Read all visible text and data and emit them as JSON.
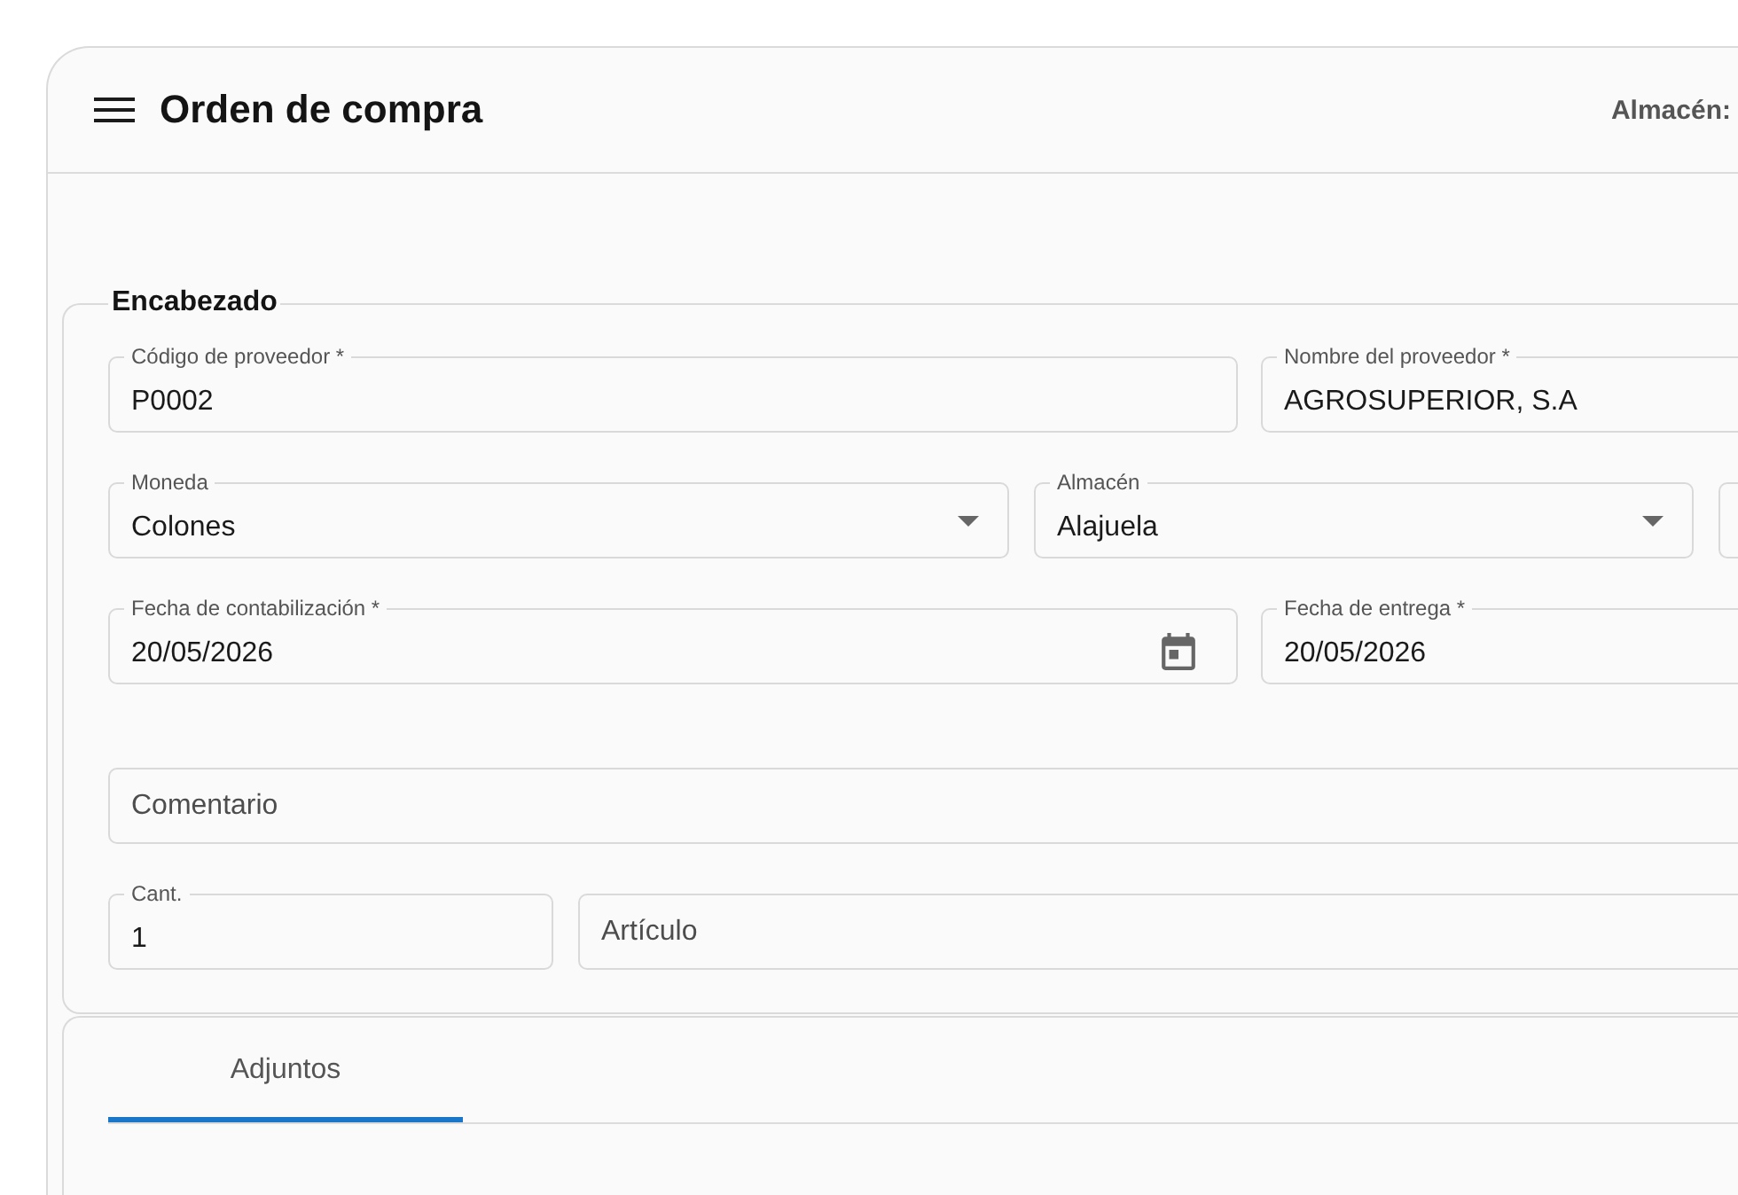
{
  "header": {
    "title": "Orden de compra",
    "warehouse_label": "Almacén:"
  },
  "encabezado": {
    "title": "Encabezado",
    "rows": [
      [
        {
          "kind": "text",
          "label": "Código de proveedor *",
          "value": "P0002"
        },
        {
          "kind": "text",
          "label": "Nombre del proveedor *",
          "value": "AGROSUPERIOR, S.A"
        }
      ],
      [
        {
          "kind": "select",
          "label": "Moneda",
          "value": "Colones"
        },
        {
          "kind": "select",
          "label": "Almacén",
          "value": "Alajuela"
        },
        {
          "kind": "text"
        }
      ],
      [
        {
          "kind": "date",
          "label": "Fecha de contabilización *",
          "value": "20/05/2026"
        },
        {
          "kind": "text",
          "label": "Fecha de entrega *",
          "value": "20/05/2026"
        }
      ],
      [
        {
          "kind": "text",
          "placeholder": "Comentario"
        }
      ],
      [
        {
          "kind": "text",
          "label": "Cant.",
          "value": "1"
        },
        {
          "kind": "text",
          "placeholder": "Artículo"
        }
      ]
    ]
  },
  "tabs": [
    {
      "label": "Adjuntos",
      "selected": true
    }
  ]
}
